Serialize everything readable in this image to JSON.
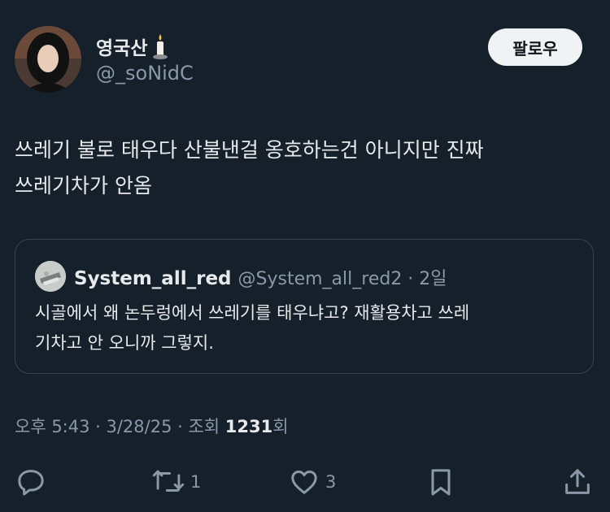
{
  "author": {
    "display_name": "영국산",
    "handle": "@_soNidC"
  },
  "follow_label": "팔로우",
  "tweet_text_line1": "쓰레기 불로 태우다 산불낸걸 옹호하는건 아니지만 진짜",
  "tweet_text_line2": "쓰레기차가 안옴",
  "quoted": {
    "display_name": "System_all_red",
    "meta": "@System_all_red2 · 2일",
    "text_line1": "시골에서 왜 논두렁에서 쓰레기를 태우냐고? 재활용차고 쓰레",
    "text_line2": "기차고 안 오니까 그렇지."
  },
  "meta": {
    "time_date": "오후 5:43 · 3/28/25 · 조회 ",
    "views": "1231",
    "views_suffix": "회"
  },
  "actions": {
    "retweet_count": "1",
    "like_count": "3"
  },
  "icons": [
    "reply-icon",
    "retweet-icon",
    "like-icon",
    "bookmark-icon",
    "share-icon",
    "candle-icon"
  ],
  "colors": {
    "background": "#15202b",
    "text": "#e7e9ea",
    "secondary_text": "#8b98a5",
    "border": "#38444d",
    "button_bg": "#eff3f4"
  }
}
